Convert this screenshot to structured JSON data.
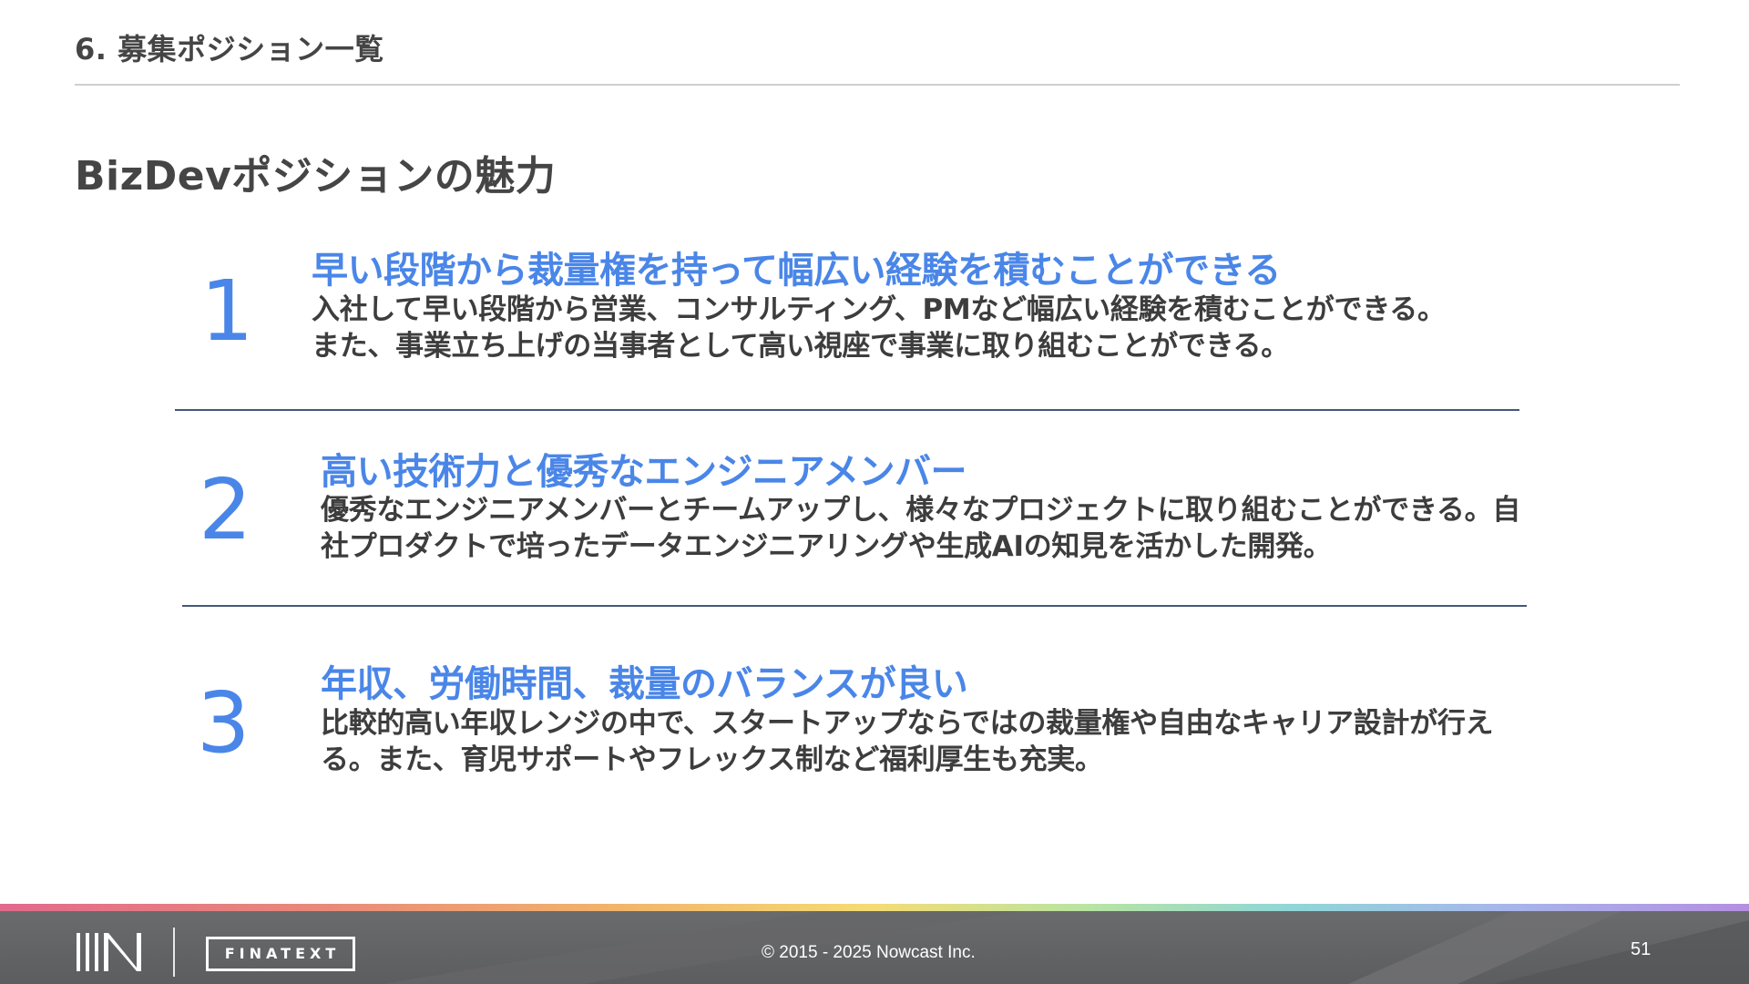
{
  "header": {
    "section_title": "6. 募集ポジション一覧"
  },
  "page": {
    "heading": "BizDevポジションの魅力"
  },
  "items": [
    {
      "number": "1",
      "title": "早い段階から裁量権を持って幅広い経験を積むことができる",
      "description_lines": [
        "入社して早い段階から営業、コンサルティング、PMなど幅広い経験を積むことができる。",
        "また、事業立ち上げの当事者として高い視座で事業に取り組むことができる。"
      ]
    },
    {
      "number": "2",
      "title": "高い技術力と優秀なエンジニアメンバー",
      "description_lines": [
        "優秀なエンジニアメンバーとチームアップし、様々なプロジェクトに取り組むことができる。自",
        "社プロダクトで培ったデータエンジニアリングや生成AIの知見を活かした開発。"
      ]
    },
    {
      "number": "3",
      "title": "年収、労働時間、裁量のバランスが良い",
      "description_lines": [
        "比較的高い年収レンジの中で、スタートアップならではの裁量権や自由なキャリア設計が行え",
        "る。また、育児サポートやフレックス制など福利厚生も充実。"
      ]
    }
  ],
  "footer": {
    "logo_text": "FINATEXT",
    "copyright": "© 2015 - 2025 Nowcast Inc.",
    "page_number": "51",
    "stripe_colors": [
      "#e26a8c",
      "#f2b36a",
      "#f4dc74",
      "#8fd6d8",
      "#b48fe0"
    ],
    "background_color": "#5f6062"
  },
  "colors": {
    "accent": "#4a86e8",
    "text": "#3d3d3d",
    "divider": "#44577a"
  }
}
